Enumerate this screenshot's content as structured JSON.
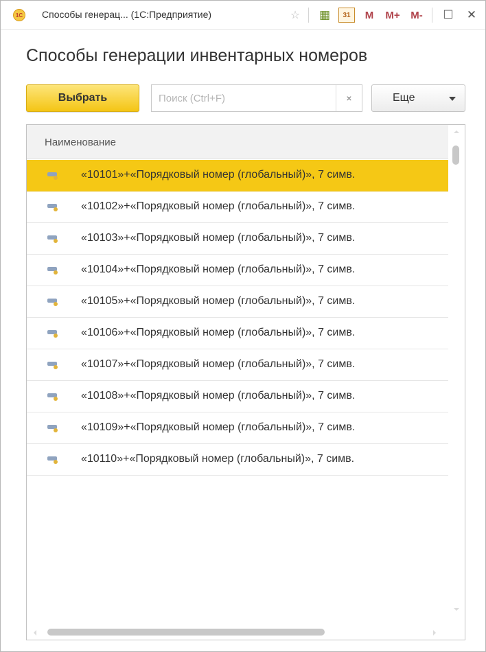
{
  "window": {
    "title": "Способы генерац...  (1С:Предприятие)",
    "logo_text": "1С",
    "buttons": {
      "favorite": "☆",
      "calculator": "▦",
      "calendar": "31",
      "m": "M",
      "m_plus": "M+",
      "m_minus": "M-",
      "maximize": "☐",
      "close": "✕"
    }
  },
  "form": {
    "title": "Способы генерации инвентарных номеров"
  },
  "toolbar": {
    "select_label": "Выбрать",
    "search_placeholder": "Поиск (Ctrl+F)",
    "search_value": "",
    "clear_label": "×",
    "more_label": "Еще"
  },
  "table": {
    "column_header": "Наименование",
    "selected_index": 0,
    "rows": [
      {
        "label": "«10101»+«Порядковый номер (глобальный)», 7 симв."
      },
      {
        "label": "«10102»+«Порядковый номер (глобальный)», 7 симв."
      },
      {
        "label": "«10103»+«Порядковый номер (глобальный)», 7 симв."
      },
      {
        "label": "«10104»+«Порядковый номер (глобальный)», 7 симв."
      },
      {
        "label": "«10105»+«Порядковый номер (глобальный)», 7 симв."
      },
      {
        "label": "«10106»+«Порядковый номер (глобальный)», 7 симв."
      },
      {
        "label": "«10107»+«Порядковый номер (глобальный)», 7 симв."
      },
      {
        "label": "«10108»+«Порядковый номер (глобальный)», 7 симв."
      },
      {
        "label": "«10109»+«Порядковый номер (глобальный)», 7 симв."
      },
      {
        "label": "«10110»+«Порядковый номер (глобальный)», 7 симв."
      }
    ]
  },
  "colors": {
    "accent": "#f5c815",
    "selected_row": "#f5c815",
    "m_buttons": "#b0434b"
  }
}
